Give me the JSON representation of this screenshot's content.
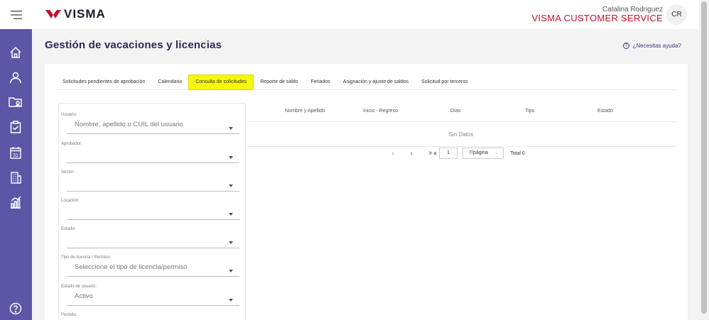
{
  "header": {
    "brand": "VISMA",
    "user_name": "Catalina Rodriguez",
    "company": "VISMA CUSTOMER SERVICE",
    "avatar_initials": "CR"
  },
  "page": {
    "title": "Gestión de vacaciones y licencias",
    "help": "¿Necesitas ayuda?"
  },
  "tabs": [
    {
      "label": "Solicitudes pendientes de aprobación",
      "active": false
    },
    {
      "label": "Calendario",
      "active": false
    },
    {
      "label": "Consulta de solicitudes",
      "active": true
    },
    {
      "label": "Reporte de saldo",
      "active": false
    },
    {
      "label": "Feriados",
      "active": false
    },
    {
      "label": "Asignación y ajuste de saldos",
      "active": false
    },
    {
      "label": "Solicitud por terceros",
      "active": false
    }
  ],
  "filters": [
    {
      "label": "Usuario:",
      "value": "Nombre, apellido o CUIL del usuario"
    },
    {
      "label": "Aprobador:",
      "value": ""
    },
    {
      "label": "Sector:",
      "value": ""
    },
    {
      "label": "Locación:",
      "value": ""
    },
    {
      "label": "Estado:",
      "value": ""
    },
    {
      "label": "Tipo de licencia / Permiso:",
      "value": "Seleccione el tipo de licencia/permiso"
    },
    {
      "label": "Estado de usuario:",
      "value": "Activo"
    },
    {
      "label": "Periodo:",
      "value": ""
    }
  ],
  "table": {
    "columns": [
      "Nombre y Apellido",
      "Inicio - Regreso",
      "Días",
      "Tipo",
      "Estado"
    ],
    "empty_text": "Sin Datos"
  },
  "pagination": {
    "goto_label": "Ir a",
    "page": "1",
    "page_size": "7/página",
    "total": "Total 0"
  },
  "colors": {
    "sidebar": "#5b57a6",
    "brand_red": "#c8102e",
    "active_tab": "#f6f60e",
    "title": "#2b2a55"
  },
  "sidebar_icons": [
    "home-icon",
    "user-icon",
    "folder-users-icon",
    "clipboard-check-icon",
    "calendar-icon",
    "building-icon",
    "chart-icon",
    "help-icon"
  ]
}
